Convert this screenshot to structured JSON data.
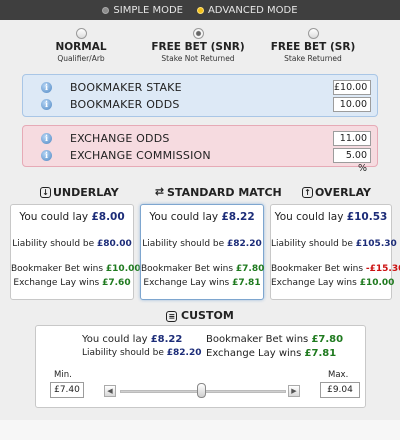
{
  "topbar": {
    "simple_label": "SIMPLE MODE",
    "advanced_label": "ADVANCED MODE",
    "selected": "advanced",
    "accent_color": "#f3c01a"
  },
  "modes": [
    {
      "name": "NORMAL",
      "sub": "Qualifier/Arb",
      "selected": false
    },
    {
      "name": "FREE BET (SNR)",
      "sub": "Stake Not Returned",
      "selected": true
    },
    {
      "name": "FREE BET (SR)",
      "sub": "Stake Returned",
      "selected": false
    }
  ],
  "bookmaker": {
    "stake_label": "BOOKMAKER STAKE",
    "stake_value": "£10.00",
    "odds_label": "BOOKMAKER ODDS",
    "odds_value": "10.00",
    "color": "#dde9f6"
  },
  "exchange": {
    "odds_label": "EXCHANGE ODDS",
    "odds_value": "11.00",
    "commission_label": "EXCHANGE COMMISSION",
    "commission_value": "5.00 %",
    "color": "#f6dbe0"
  },
  "columns": {
    "underlay": {
      "title": "UNDERLAY",
      "lay_prefix": "You could lay",
      "lay_value": "£8.00",
      "liability_prefix": "Liability should be",
      "liability_value": "£80.00",
      "bm_prefix": "Bookmaker Bet wins",
      "bm_value": "£10.00",
      "ex_prefix": "Exchange Lay wins",
      "ex_value": "£7.60"
    },
    "standard": {
      "title": "STANDARD MATCH",
      "lay_prefix": "You could lay",
      "lay_value": "£8.22",
      "liability_prefix": "Liability should be",
      "liability_value": "£82.20",
      "bm_prefix": "Bookmaker Bet wins",
      "bm_value": "£7.80",
      "ex_prefix": "Exchange Lay wins",
      "ex_value": "£7.81"
    },
    "overlay": {
      "title": "OVERLAY",
      "lay_prefix": "You could lay",
      "lay_value": "£10.53",
      "liability_prefix": "Liability should be",
      "liability_value": "£105.30",
      "bm_prefix": "Bookmaker Bet wins",
      "bm_value": "-£15.30",
      "ex_prefix": "Exchange Lay wins",
      "ex_value": "£10.00"
    }
  },
  "custom": {
    "title": "CUSTOM",
    "lay_prefix": "You could lay",
    "lay_value": "£8.22",
    "liability_prefix": "Liability should be",
    "liability_value": "£82.20",
    "bm_prefix": "Bookmaker Bet wins",
    "bm_value": "£7.80",
    "ex_prefix": "Exchange Lay wins",
    "ex_value": "£7.81",
    "min_label": "Min.",
    "min_value": "£7.40",
    "max_label": "Max.",
    "max_value": "£9.04",
    "slider_left_glyph": "◀",
    "slider_right_glyph": "▶"
  }
}
